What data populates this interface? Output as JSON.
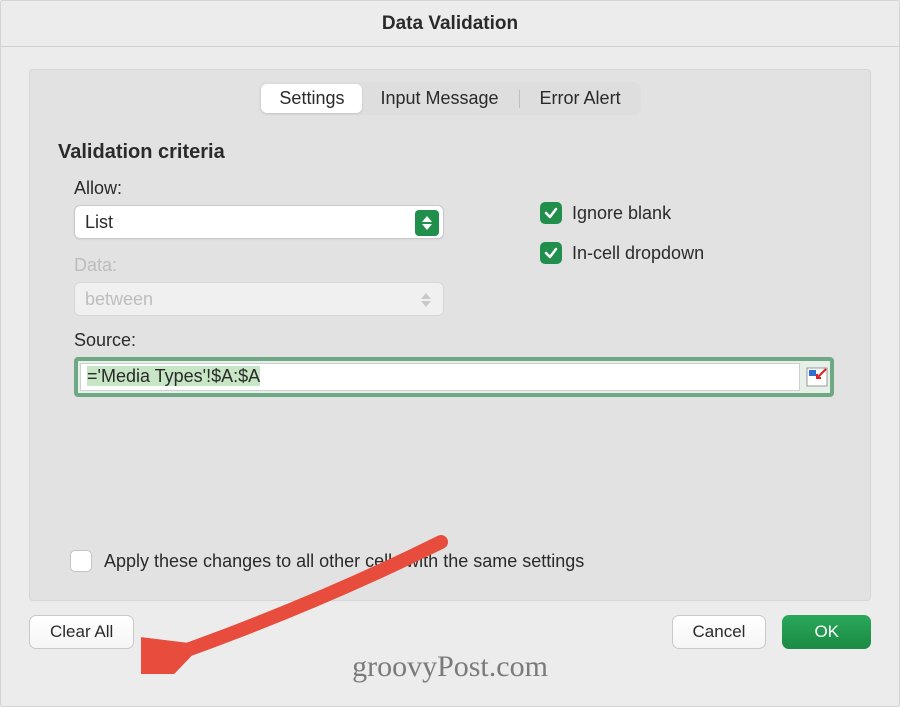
{
  "window": {
    "title": "Data Validation"
  },
  "tabs": {
    "settings": "Settings",
    "input_message": "Input Message",
    "error_alert": "Error Alert",
    "active": "settings"
  },
  "section": {
    "title": "Validation criteria"
  },
  "allow": {
    "label": "Allow:",
    "value": "List"
  },
  "data_field": {
    "label": "Data:",
    "value": "between",
    "enabled": false
  },
  "checkboxes": {
    "ignore_blank": {
      "label": "Ignore blank",
      "checked": true
    },
    "in_cell_dropdown": {
      "label": "In-cell dropdown",
      "checked": true
    },
    "apply_all": {
      "label": "Apply these changes to all other cells with the same settings",
      "checked": false
    }
  },
  "source": {
    "label": "Source:",
    "value": "='Media Types'!$A:$A"
  },
  "buttons": {
    "clear_all": "Clear All",
    "cancel": "Cancel",
    "ok": "OK"
  },
  "watermark": "groovyPost.com",
  "colors": {
    "accent": "#1f8f4b",
    "focus_ring": "#6fa884"
  }
}
